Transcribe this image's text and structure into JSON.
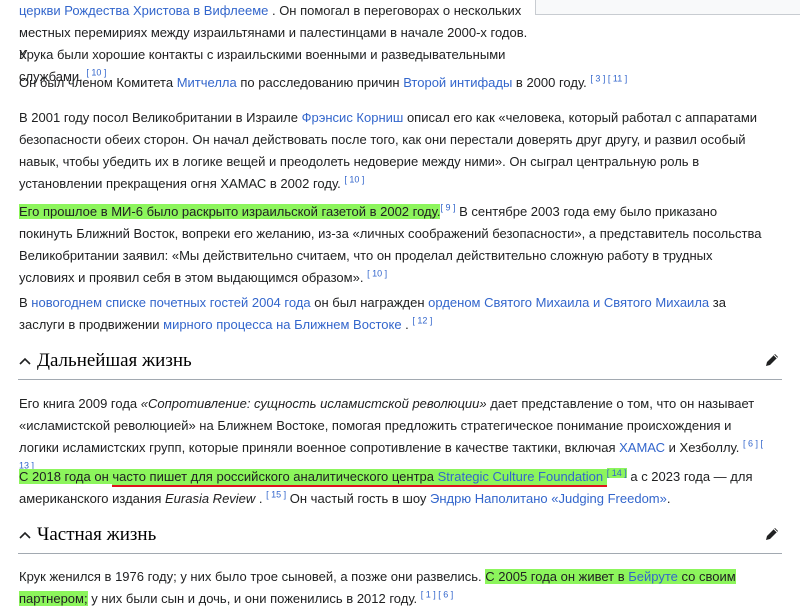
{
  "p0": {
    "l1_link": "церкви Рождества Христова в Вифлееме",
    "l1_text": " . Он помогал в переговорах о нескольких",
    "l2": "местных перемириях между израильтянами и палестинцами в начале 2000-х годов. У",
    "l3": "Крука были хорошие контакты с израильскими военными и разведывательными службами.",
    "ref": "[ 10 ]"
  },
  "p1": {
    "t1": "Он был членом Комитета ",
    "link1": "Митчелла",
    "t2": " по расследованию причин ",
    "link2": "Второй интифады",
    "t3": " в 2000 году. ",
    "ref": "[ 3 ] [ 11 ]"
  },
  "p2": {
    "t1": "В 2001 году посол Великобритании в Израиле ",
    "link1": "Фрэнсис Корниш",
    "t2": " описал его как «человека, который работал с аппаратами безопасности обеих сторон. Он начал действовать после того, как они перестали доверять друг другу, и развил особый навык, чтобы убедить их в логике вещей и преодолеть недоверие между ними». Он сыграл центральную роль в установлении прекращения огня ХАМАС в 2002 году. ",
    "ref": "[ 10 ]"
  },
  "p3": {
    "hl_text": "Его прошлое в МИ-6 было раскрыто израильской газетой в 2002 году.",
    "ref1": "[ 9 ]",
    "t1": " В сентябре 2003 года ему было приказано покинуть Ближний Восток, вопреки его желанию, из-за «личных соображений безопасности», а представитель посольства Великобритании заявил: «Мы действительно считаем, что он проделал действительно сложную работу в трудных условиях и проявил себя в этом выдающимся образом». ",
    "ref2": "[ 10 ]"
  },
  "p4": {
    "t1": "В ",
    "link1": "новогоднем списке почетных гостей 2004 года",
    "t2": " он был награжден ",
    "link2": "орденом Святого Михаила и Святого Михаила",
    "t3": " за заслуги в продвижении ",
    "link3": "мирного процесса на Ближнем Востоке",
    "t4": " . ",
    "ref": "[ 12 ]"
  },
  "h1": {
    "title": "Дальнейшая жизнь"
  },
  "p5": {
    "t1": "Его книга 2009 года ",
    "italic": "«Сопротивление: сущность исламистской революции»",
    "t2": " дает представление о том, что он называет «исламистской революцией» на Ближнем Востоке, помогая предложить стратегическое понимание происхождения и логики исламистских групп, которые приняли военное сопротивление в качестве тактики, включая ",
    "link1": "ХАМАС",
    "t3": " и Хезболлу. ",
    "ref": "[ 6 ] [ 13 ]"
  },
  "p6": {
    "hl1": "С 2018 года он ",
    "hl_ul": "часто пишет для российского аналитического центра ",
    "link1": "Strategic Culture Foundation",
    "ref1": "[ 14 ]",
    "t1": " а с 2023 года — для американского издания ",
    "italic": "Eurasia Review",
    "t2": " . ",
    "ref2": "[ 15 ]",
    "t3": " Он частый гость в шоу ",
    "link2": "Эндрю Наполитано «Judging Freedom»",
    "t4": "."
  },
  "h2": {
    "title": "Частная жизнь"
  },
  "p7": {
    "t1": "Крук женился в 1976 году; у них было трое сыновей, а позже они развелись. ",
    "hl1": "С 2005 года он живет в ",
    "link1": "Бейруте",
    "hl2": " со своим партнером;",
    "t2": " у них были сын и дочь, и они поженились в 2012 году. ",
    "ref": "[ 1 ] [ 6 ]"
  }
}
